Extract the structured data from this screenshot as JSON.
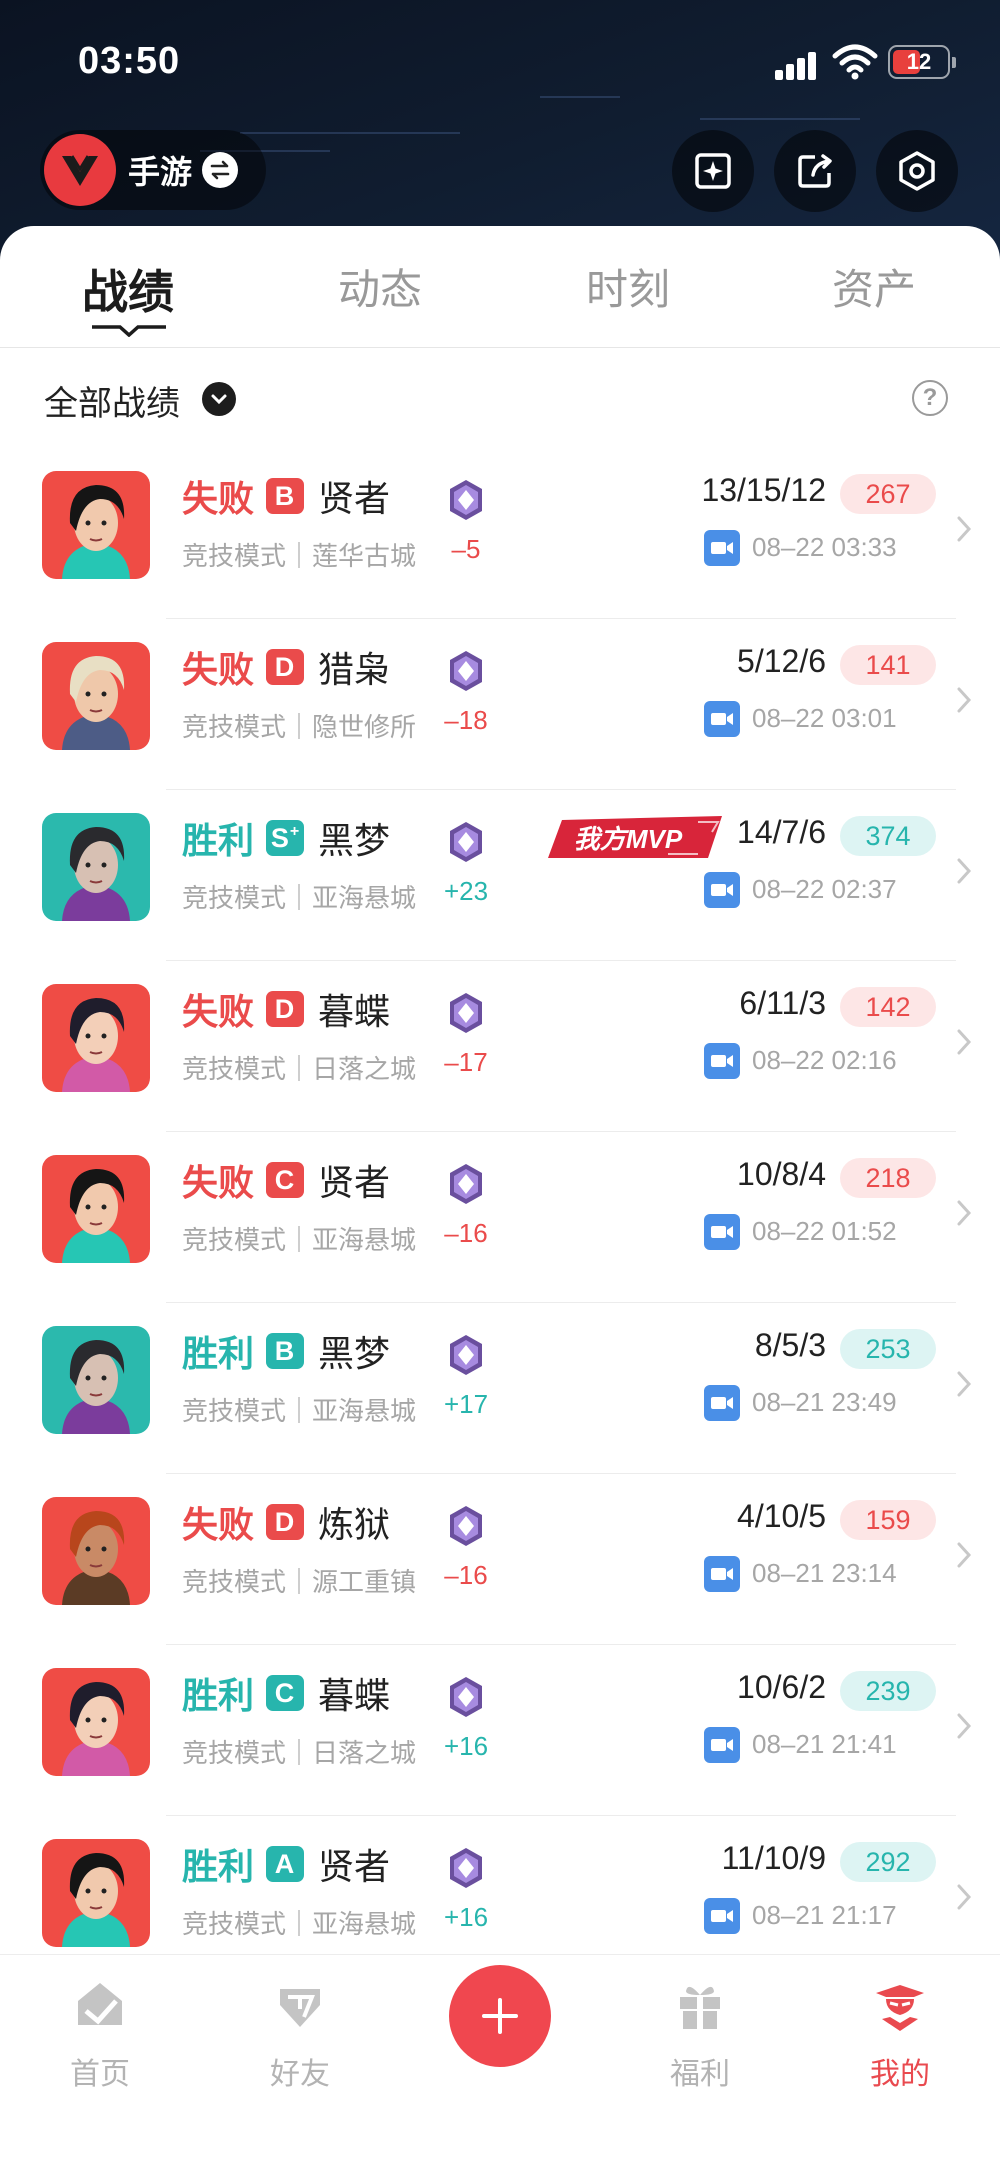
{
  "status_bar": {
    "time": "03:50",
    "battery": "12"
  },
  "header": {
    "game_name": "手游"
  },
  "tabs": [
    {
      "label": "战绩"
    },
    {
      "label": "动态"
    },
    {
      "label": "时刻"
    },
    {
      "label": "资产"
    }
  ],
  "filter": {
    "label": "全部战绩",
    "help": "?"
  },
  "colors": {
    "loss": "#ea4b4b",
    "win": "#27b5ad",
    "accent": "#e94a4f"
  },
  "matches": [
    {
      "result": "失败",
      "outcome": "loss",
      "grade": "B",
      "grade_sup": "",
      "hero": "贤者",
      "mode": "竞技模式｜莲华古城",
      "delta": "–5",
      "kda": "13/15/12",
      "score": "267",
      "date": "08–22 03:33",
      "mvp": "",
      "avatar": "sage"
    },
    {
      "result": "失败",
      "outcome": "loss",
      "grade": "D",
      "grade_sup": "",
      "hero": "猎枭",
      "mode": "竞技模式｜隐世修所",
      "delta": "–18",
      "kda": "5/12/6",
      "score": "141",
      "date": "08–22 03:01",
      "mvp": "",
      "avatar": "sova"
    },
    {
      "result": "胜利",
      "outcome": "win",
      "grade": "S",
      "grade_sup": "+",
      "hero": "黑梦",
      "mode": "竞技模式｜亚海悬城",
      "delta": "+23",
      "kda": "14/7/6",
      "score": "374",
      "date": "08–22 02:37",
      "mvp": "我方MVP",
      "avatar": "fade"
    },
    {
      "result": "失败",
      "outcome": "loss",
      "grade": "D",
      "grade_sup": "",
      "hero": "暮蝶",
      "mode": "竞技模式｜日落之城",
      "delta": "–17",
      "kda": "6/11/3",
      "score": "142",
      "date": "08–22 02:16",
      "mvp": "",
      "avatar": "clove"
    },
    {
      "result": "失败",
      "outcome": "loss",
      "grade": "C",
      "grade_sup": "",
      "hero": "贤者",
      "mode": "竞技模式｜亚海悬城",
      "delta": "–16",
      "kda": "10/8/4",
      "score": "218",
      "date": "08–22 01:52",
      "mvp": "",
      "avatar": "sage"
    },
    {
      "result": "胜利",
      "outcome": "win",
      "grade": "B",
      "grade_sup": "",
      "hero": "黑梦",
      "mode": "竞技模式｜亚海悬城",
      "delta": "+17",
      "kda": "8/5/3",
      "score": "253",
      "date": "08–21 23:49",
      "mvp": "",
      "avatar": "fade"
    },
    {
      "result": "失败",
      "outcome": "loss",
      "grade": "D",
      "grade_sup": "",
      "hero": "炼狱",
      "mode": "竞技模式｜源工重镇",
      "delta": "–16",
      "kda": "4/10/5",
      "score": "159",
      "date": "08–21 23:14",
      "mvp": "",
      "avatar": "brimstone"
    },
    {
      "result": "胜利",
      "outcome": "win",
      "grade": "C",
      "grade_sup": "",
      "hero": "暮蝶",
      "mode": "竞技模式｜日落之城",
      "delta": "+16",
      "kda": "10/6/2",
      "score": "239",
      "date": "08–21 21:41",
      "mvp": "",
      "avatar": "clove"
    },
    {
      "result": "胜利",
      "outcome": "win",
      "grade": "A",
      "grade_sup": "",
      "hero": "贤者",
      "mode": "竞技模式｜亚海悬城",
      "delta": "+16",
      "kda": "11/10/9",
      "score": "292",
      "date": "08–21 21:17",
      "mvp": "",
      "avatar": "sage"
    }
  ],
  "bottom_nav": [
    {
      "label": "首页",
      "icon": "home-icon"
    },
    {
      "label": "好友",
      "icon": "friends-icon"
    },
    {
      "label": "福利",
      "icon": "gift-icon"
    },
    {
      "label": "我的",
      "icon": "profile-icon"
    }
  ]
}
